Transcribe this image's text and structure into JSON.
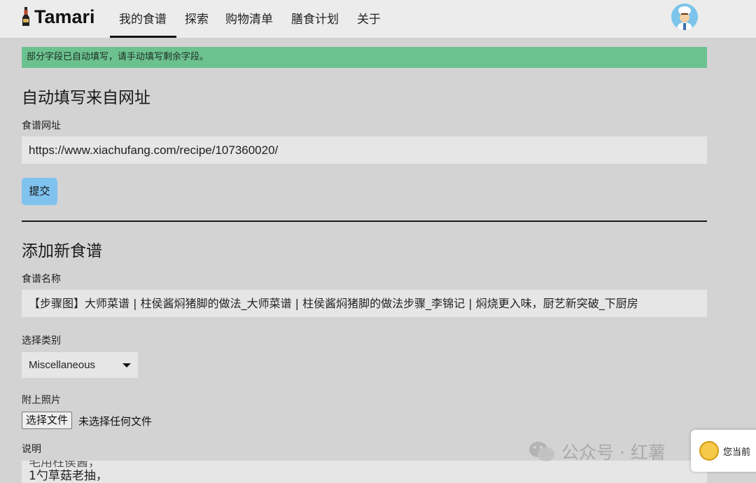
{
  "app": {
    "brand": "Tamari"
  },
  "nav": {
    "links": [
      "我的食谱",
      "探索",
      "购物清单",
      "膳食计划",
      "关于"
    ],
    "active": "我的食谱"
  },
  "alert": {
    "message": "部分字段已自动填写，请手动填写剩余字段。",
    "color": "#6cc28f"
  },
  "autofill": {
    "heading": "自动填写来自网址",
    "url_label": "食谱网址",
    "url_value": "https://www.xiachufang.com/recipe/107360020/",
    "submit_label": "提交"
  },
  "new_recipe": {
    "heading": "添加新食谱",
    "name_label": "食谱名称",
    "name_value": "【步骤图】大师菜谱 | 柱侯酱焖猪脚的做法_大师菜谱 | 柱侯酱焖猪脚的做法步骤_李锦记 | 焖烧更入味，厨艺新突破_下厨房",
    "category_label": "选择类别",
    "category_value": "Miscellaneous",
    "photo_label": "附上照片",
    "file_button": "选择文件",
    "file_status": "未选择任何文件",
    "description_label": "说明",
    "description_cut_line": "毛用柱侯酱，",
    "description_visible_line": "1勺草菇老抽，"
  },
  "overlays": {
    "watermark_text": "公众号 · 红薯",
    "chat_text": "您当前"
  }
}
